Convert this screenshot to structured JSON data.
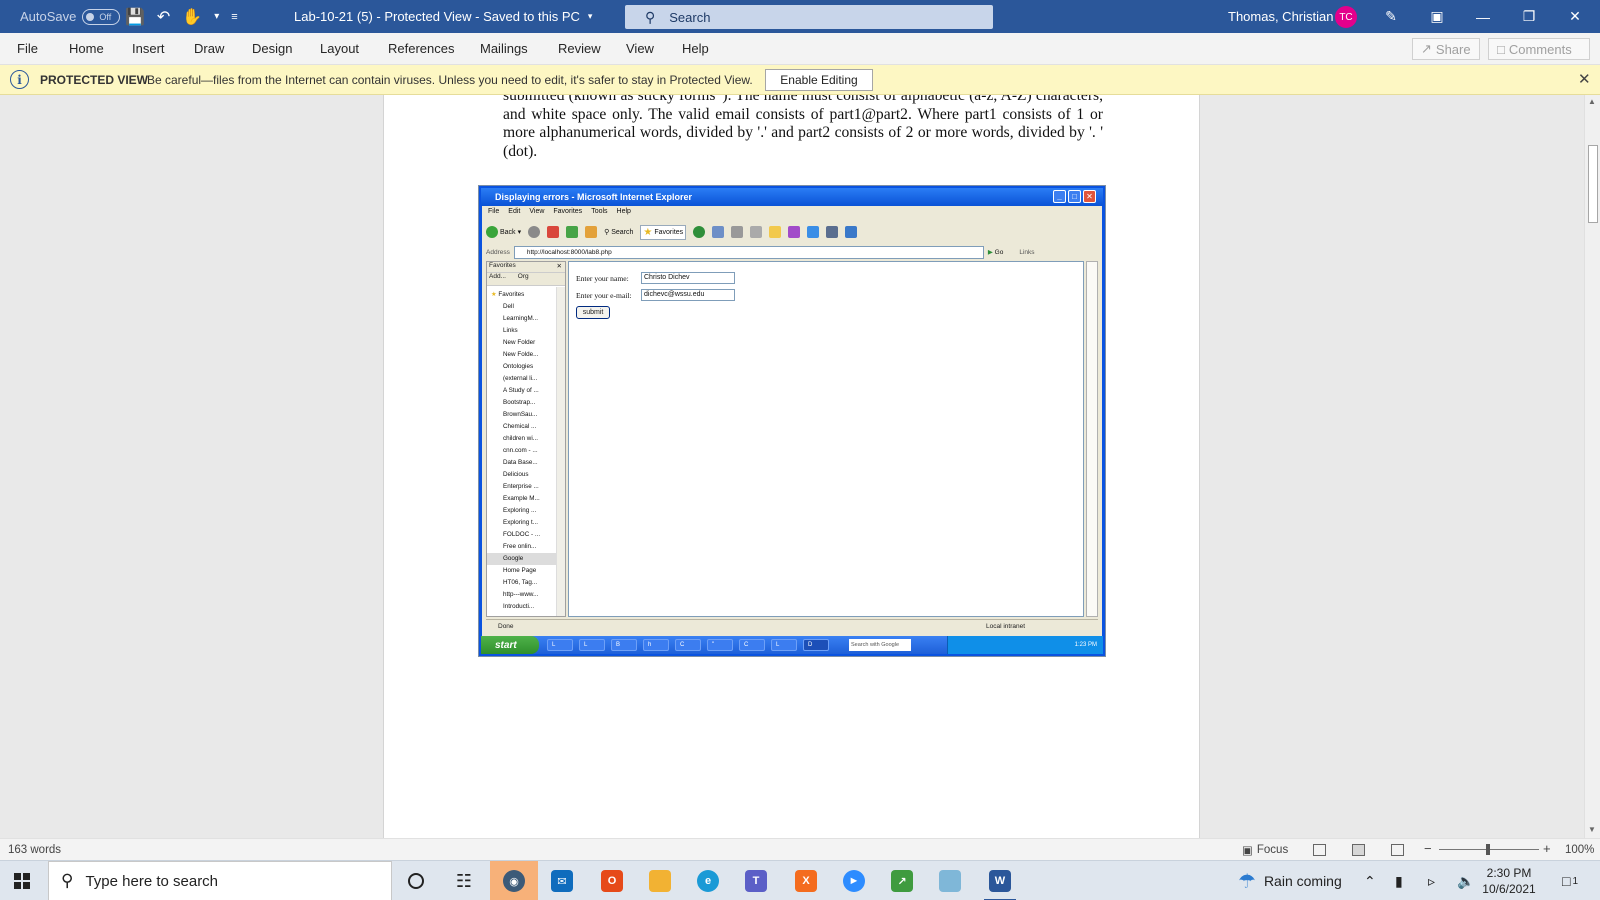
{
  "titlebar": {
    "autosave_label": "AutoSave",
    "autosave_state": "Off",
    "document_title": "Lab-10-21 (5)  -  Protected View  -  Saved to this PC",
    "search_placeholder": "Search",
    "user_name": "Thomas, Christian",
    "user_initials": "TC"
  },
  "ribbon": {
    "tabs": [
      "File",
      "Home",
      "Insert",
      "Draw",
      "Design",
      "Layout",
      "References",
      "Mailings",
      "Review",
      "View",
      "Help"
    ],
    "share_label": "Share",
    "comments_label": "Comments"
  },
  "protected_view": {
    "label": "PROTECTED VIEW",
    "message": "Be careful—files from the Internet can contain viruses. Unless you need to edit, it's safer to stay in Protected View.",
    "enable_button": "Enable Editing"
  },
  "document": {
    "paragraph": "submitted (known as sticky forms”). The name must consist of alphabetic (a-z, A-Z) characters, and white space only. The valid email consists of part1@part2. Where part1 consists of 1 or more alphanumerical words, divided by '.' and part2 consists of 2 or more words, divided by  '. ' (dot)."
  },
  "embedded_screenshot": {
    "window_title": "Displaying errors - Microsoft Internet Explorer",
    "menu": [
      "File",
      "Edit",
      "View",
      "Favorites",
      "Tools",
      "Help"
    ],
    "toolbar": {
      "back": "Back",
      "search": "Search",
      "favorites": "Favorites"
    },
    "address_label": "Address",
    "address_url": "http://localhost:8000/lab8.php",
    "go_label": "Go",
    "links_label": "Links",
    "favorites_panel": {
      "title": "Favorites",
      "add": "Add...",
      "organize": "Org",
      "root": "Favorites",
      "items": [
        "Dell",
        "LearningM...",
        "Links",
        "New Folder",
        "New Folde...",
        "Ontologies",
        "(external li...",
        "A Study of ...",
        "Bootstrap...",
        "BrownSau...",
        "Chemical ...",
        "children wi...",
        "cnn.com - ...",
        "Data Base...",
        "Delicious",
        "Enterprise ...",
        "Example M...",
        "Exploring ...",
        "Exploring t...",
        "FOLDOC - ...",
        "Free onlin...",
        "Google",
        "Home Page",
        "HT06, Tag...",
        "http---www...",
        "Introducti..."
      ],
      "selected": "Google"
    },
    "form": {
      "name_label": "Enter your name:",
      "name_value": "Christo Dichev",
      "email_label": "Enter your e-mail:",
      "email_value": "dichevc@wssu.edu",
      "submit_label": "submit"
    },
    "status_left": "Done",
    "status_right": "Local intranet",
    "start_label": "start",
    "task_items": [
      "L",
      "L",
      "B",
      "h",
      "C",
      "\"",
      "C",
      "L",
      "D"
    ],
    "search_google": "Search with Google",
    "clock": "1:23 PM"
  },
  "statusbar": {
    "word_count": "163 words",
    "focus_label": "Focus",
    "zoom": "100%",
    "zoom_minus": "−",
    "zoom_plus": "+"
  },
  "taskbar": {
    "search_placeholder": "Type here to search",
    "weather": "Rain coming",
    "time": "2:30 PM",
    "date": "10/6/2021",
    "notification_count": "1"
  }
}
